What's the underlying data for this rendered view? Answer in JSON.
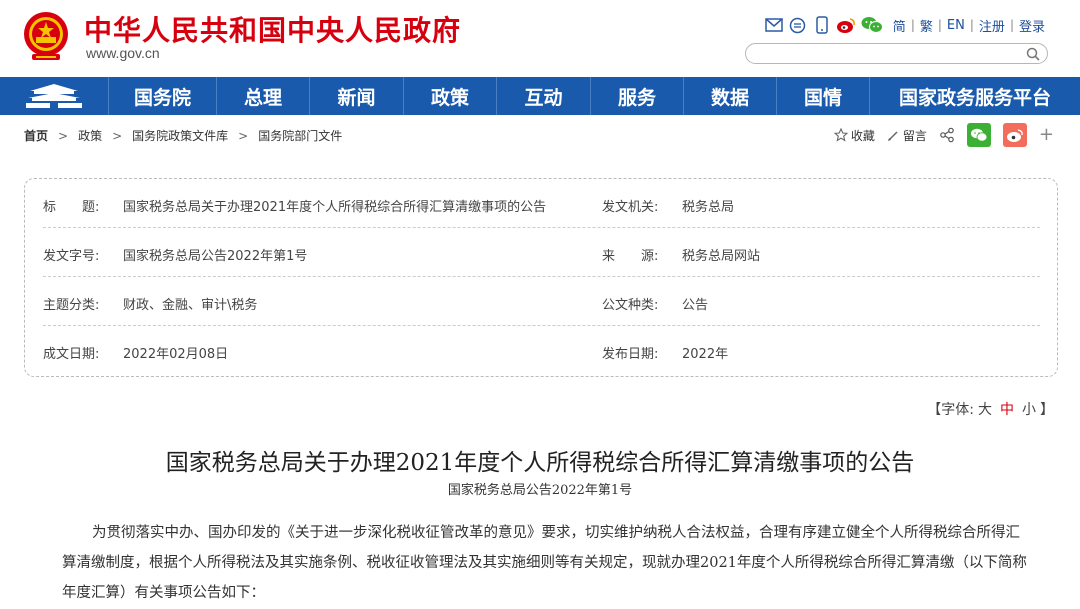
{
  "header": {
    "site_title": "中华人民共和国中央人民政府",
    "site_url": "www.gov.cn",
    "links": [
      "简",
      "繁",
      "EN",
      "注册",
      "登录"
    ],
    "search_placeholder": ""
  },
  "nav": {
    "items": [
      "国务院",
      "总理",
      "新闻",
      "政策",
      "互动",
      "服务",
      "数据",
      "国情",
      "国家政务服务平台"
    ]
  },
  "breadcrumb": [
    "首页",
    "政策",
    "国务院政策文件库",
    "国务院部门文件"
  ],
  "share": {
    "favorite": "收藏",
    "comment": "留言"
  },
  "info": {
    "rows": [
      {
        "l_label": "标　　题:",
        "l_value": "国家税务总局关于办理2021年度个人所得税综合所得汇算清缴事项的公告",
        "r_label": "发文机关:",
        "r_value": "税务总局"
      },
      {
        "l_label": "发文字号:",
        "l_value": "国家税务总局公告2022年第1号",
        "r_label": "来　　源:",
        "r_value": "税务总局网站"
      },
      {
        "l_label": "主题分类:",
        "l_value": "财政、金融、审计\\税务",
        "r_label": "公文种类:",
        "r_value": "公告"
      },
      {
        "l_label": "成文日期:",
        "l_value": "2022年02月08日",
        "r_label": "发布日期:",
        "r_value": "2022年"
      }
    ]
  },
  "fontsize": {
    "open": "【字体:",
    "options": [
      "大",
      "中",
      "小"
    ],
    "close": "】",
    "active_index": 1
  },
  "article": {
    "title": "国家税务总局关于办理2021年度个人所得税综合所得汇算清缴事项的公告",
    "subtitle": "国家税务总局公告2022年第1号",
    "body": "为贯彻落实中办、国办印发的《关于进一步深化税收征管改革的意见》要求，切实维护纳税人合法权益，合理有序建立健全个人所得税综合所得汇算清缴制度，根据个人所得税法及其实施条例、税收征收管理法及其实施细则等有关规定，现就办理2021年度个人所得税综合所得汇算清缴（以下简称年度汇算）有关事项公告如下："
  },
  "colors": {
    "brand_red": "#d7000f",
    "nav_blue": "#1a5aad",
    "wechat_green": "#3cb034",
    "weibo_orange": "#f26d5b"
  }
}
